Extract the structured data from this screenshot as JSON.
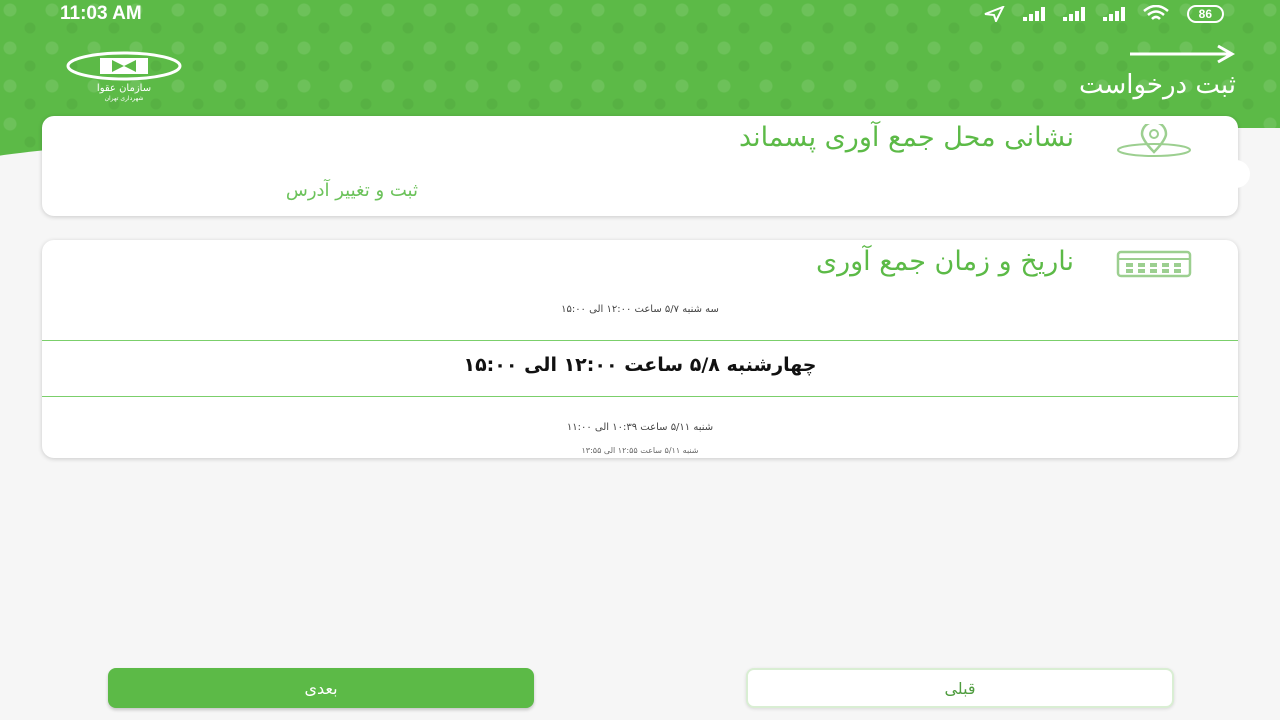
{
  "status_bar": {
    "time": "11:03 AM",
    "battery": "86"
  },
  "header": {
    "title": "ثبت درخواست",
    "logo_text": "سازمان عقوا",
    "logo_subtext": "شهرداری تهران"
  },
  "address_card": {
    "title": "نشانی محل جمع آوری پسماند",
    "link_label": "ثبت و تغییر آدرس"
  },
  "time_card": {
    "title": "ناریخ و زمان جمع  آوری",
    "slots": [
      "سه شنبه ۵/۷ ساعت ۱۲:۰۰ الی ۱۵:۰۰",
      "چهارشنبه ۵/۸ ساعت ۱۲:۰۰ الی ۱۵:۰۰",
      "شنبه ۵/۱۱ ساعت ۱۰:۳۹ الی ۱۱:۰۰",
      "شنبه ۵/۱۱ ساعت ۱۲:۵۵ الی ۱۳:۵۵"
    ]
  },
  "buttons": {
    "next": "بعدی",
    "previous": "قبلی"
  },
  "colors": {
    "primary": "#5cba47",
    "background": "#f6f6f6",
    "divider": "#7bcf6b"
  }
}
